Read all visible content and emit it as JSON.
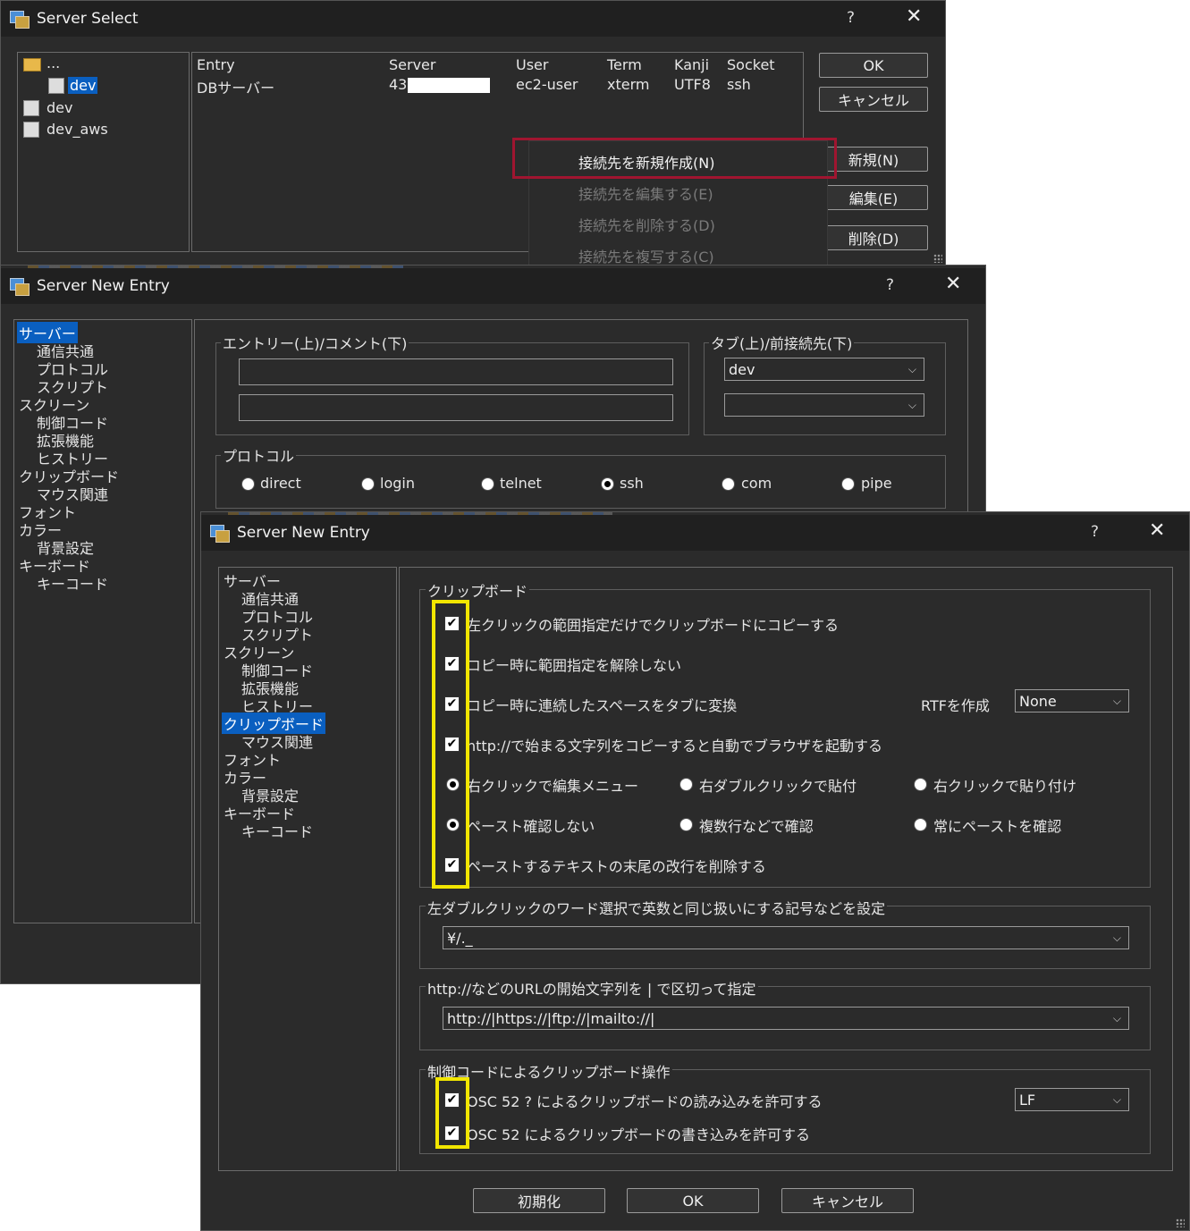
{
  "server_select": {
    "title": "Server Select",
    "help": "?",
    "close": "✕",
    "tree": [
      {
        "label": "..."
      },
      {
        "label": "dev"
      },
      {
        "label": "dev"
      },
      {
        "label": "dev_aws"
      }
    ],
    "columns": [
      "Entry",
      "Server",
      "User",
      "Term",
      "Kanji",
      "Socket"
    ],
    "row": {
      "entry": "DBサーバー",
      "server": "43",
      "user": "ec2-user",
      "term": "xterm",
      "kanji": "UTF8",
      "socket": "ssh"
    },
    "buttons": {
      "ok": "OK",
      "cancel": "キャンセル",
      "new": "新規(N)",
      "edit": "編集(E)",
      "delete": "削除(D)"
    },
    "context_menu": [
      {
        "label": "接続先を新規作成(N)"
      },
      {
        "label": "接続先を編集する(E)"
      },
      {
        "label": "接続先を削除する(D)"
      },
      {
        "label": "接続先を複写する(C)"
      }
    ]
  },
  "new_entry_back": {
    "title": "Server New Entry",
    "help": "?",
    "close": "✕",
    "tree": [
      "サーバー",
      "通信共通",
      "プロトコル",
      "スクリプト",
      "スクリーン",
      "制御コード",
      "拡張機能",
      "ヒストリー",
      "クリップボード",
      "マウス関連",
      "フォント",
      "カラー",
      "背景設定",
      "キーボード",
      "キーコード"
    ],
    "entry_group": "エントリー(上)/コメント(下)",
    "tab_group": "タブ(上)/前接続先(下)",
    "tab_value": "dev",
    "protocol_group": "プロトコル",
    "protocols": [
      "direct",
      "login",
      "telnet",
      "ssh",
      "com",
      "pipe"
    ],
    "protocol_selected": "ssh"
  },
  "new_entry_front": {
    "title": "Server New Entry",
    "help": "?",
    "close": "✕",
    "tree": [
      "サーバー",
      "通信共通",
      "プロトコル",
      "スクリプト",
      "スクリーン",
      "制御コード",
      "拡張機能",
      "ヒストリー",
      "クリップボード",
      "マウス関連",
      "フォント",
      "カラー",
      "背景設定",
      "キーボード",
      "キーコード"
    ],
    "clipboard_group": "クリップボード",
    "opt1": "左クリックの範囲指定だけでクリップボードにコピーする",
    "opt2": "コピー時に範囲指定を解除しない",
    "opt3": "コピー時に連続したスペースをタブに変換",
    "rtf_label": "RTFを作成",
    "rtf_value": "None",
    "opt4": "http://で始まる文字列をコピーすると自動でブラウザを起動する",
    "r1a": "右クリックで編集メニュー",
    "r1b": "右ダブルクリックで貼付",
    "r1c": "右クリックで貼り付け",
    "r2a": "ペースト確認しない",
    "r2b": "複数行などで確認",
    "r2c": "常にペーストを確認",
    "opt5": "ペーストするテキストの末尾の改行を削除する",
    "word_group": "左ダブルクリックのワード選択で英数と同じ扱いにする記号などを設定",
    "word_value": "¥/._",
    "url_group": "http://などのURLの開始文字列を | で区切って指定",
    "url_value": "http://|https://|ftp://|mailto://|",
    "osc_group": "制御コードによるクリップボード操作",
    "osc1": "OSC 52 ? によるクリップボードの読み込みを許可する",
    "osc2": "OSC 52 によるクリップボードの書き込みを許可する",
    "lf_value": "LF",
    "buttons": {
      "reset": "初期化",
      "ok": "OK",
      "cancel": "キャンセル"
    }
  }
}
